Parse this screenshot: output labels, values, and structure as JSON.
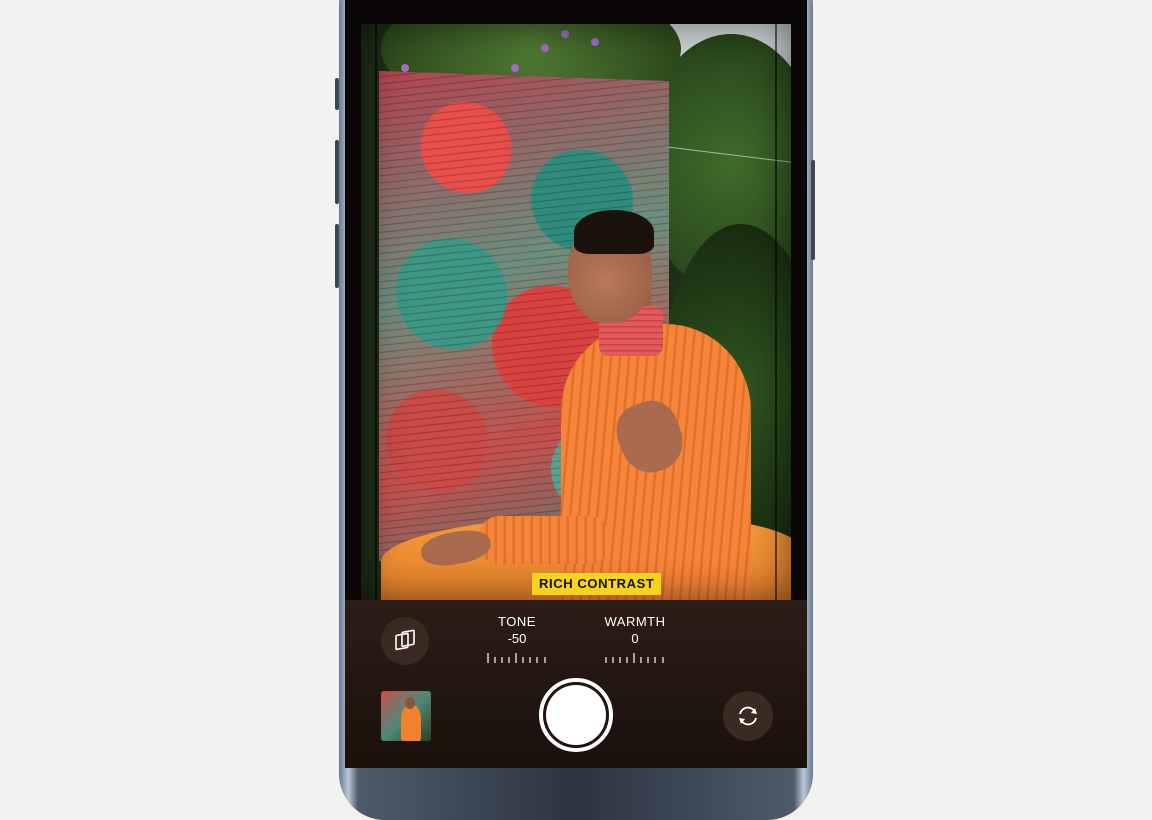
{
  "viewfinder": {
    "style_name": "RICH CONTRAST",
    "style_pages": 5,
    "active_style_index": 1
  },
  "controls": {
    "tone": {
      "label": "TONE",
      "value": "-50"
    },
    "warmth": {
      "label": "WARMTH",
      "value": "0"
    }
  },
  "icons": {
    "styles": "photographic-styles-icon",
    "flip": "camera-flip-icon",
    "shutter": "shutter-button",
    "thumbnail": "last-photo-thumbnail"
  },
  "colors": {
    "badge_bg": "#f7d31d",
    "controls_bg": "#2c1d16"
  }
}
